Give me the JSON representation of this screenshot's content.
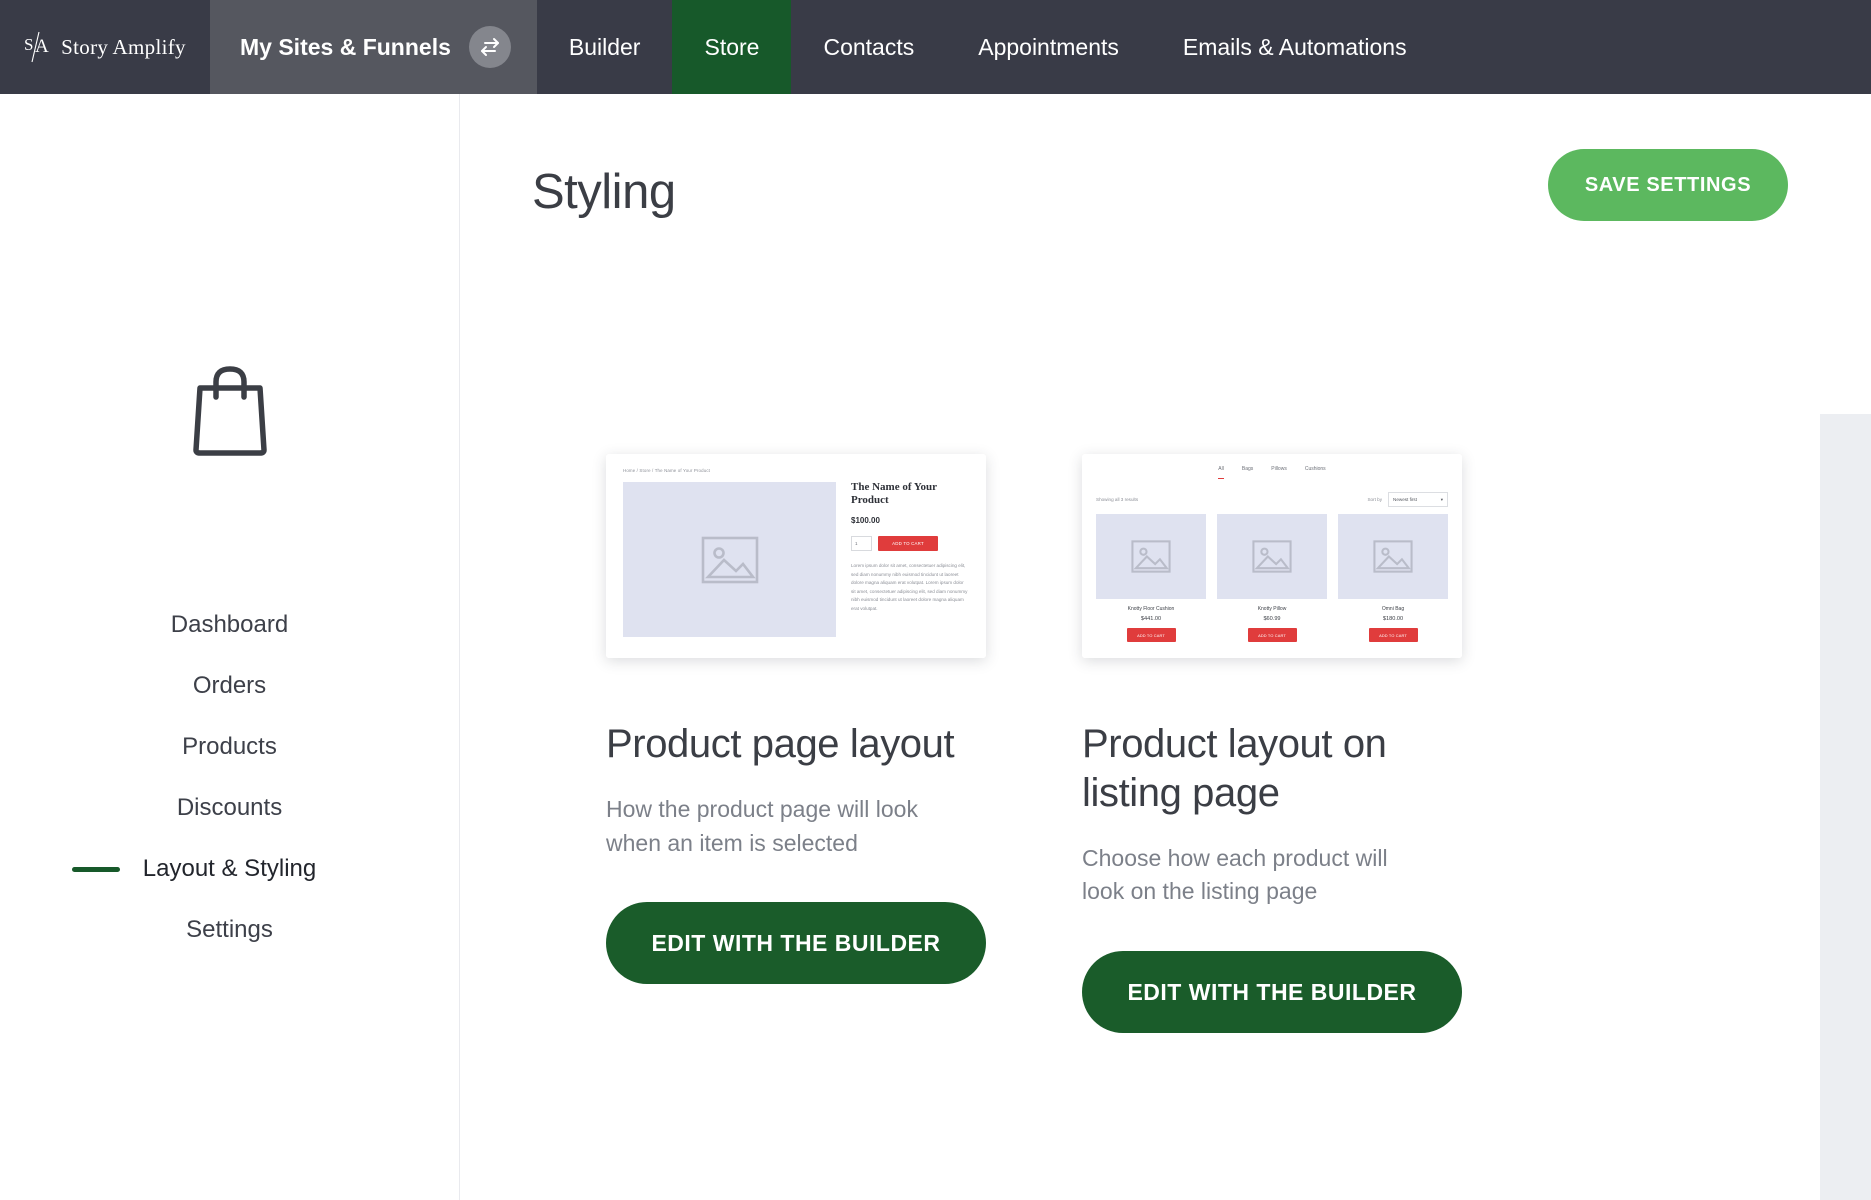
{
  "brand": {
    "name": "Story Amplify",
    "logo_icon": "story-amplify-monogram"
  },
  "topnav": {
    "tabs": [
      {
        "label": "My Sites & Funnels",
        "active": true,
        "icon": "swap-arrows-icon"
      },
      {
        "label": "Builder",
        "active": false
      },
      {
        "label": "Store",
        "active": true
      },
      {
        "label": "Contacts",
        "active": false
      },
      {
        "label": "Appointments",
        "active": false
      },
      {
        "label": "Emails & Automations",
        "active": false
      }
    ],
    "active_accent": "#17592a"
  },
  "sidebar": {
    "icon": "shopping-bag-icon",
    "items": [
      {
        "label": "Dashboard",
        "active": false
      },
      {
        "label": "Orders",
        "active": false
      },
      {
        "label": "Products",
        "active": false
      },
      {
        "label": "Discounts",
        "active": false
      },
      {
        "label": "Layout & Styling",
        "active": true
      },
      {
        "label": "Settings",
        "active": false
      }
    ],
    "active_indicator_color": "#17592a"
  },
  "header": {
    "title": "Styling",
    "save_label": "SAVE SETTINGS",
    "save_color": "#5cb85f"
  },
  "cards": [
    {
      "title": "Product page layout",
      "description": "How the product page will look when an item is selected",
      "button_label": "EDIT WITH THE BUILDER",
      "button_color": "#1a5c2a",
      "preview": {
        "type": "product-page",
        "breadcrumb": "Home  /  Store  /  The Name of Your Product",
        "product_name": "The Name of Your Product",
        "price": "$100.00",
        "quantity": "1",
        "add_to_cart_label": "ADD TO CART",
        "add_to_cart_color": "#e03c3c",
        "body_text": "Lorem ipsum dolor sit amet, consectetuer adipiscing elit, sed diam nonummy nibh euismod tincidunt ut laoreet dolore magna aliquam erat volutpat. Lorem ipsum dolor sit amet, consectetuer adipiscing elit, sed diam nonummy nibh euismod tincidunt ut laoreet dolore magna aliquam erat volutpat.",
        "image_placeholder_icon": "image-placeholder-icon"
      }
    },
    {
      "title": "Product layout on listing page",
      "description": "Choose how each product will look on the listing page",
      "button_label": "EDIT WITH THE BUILDER",
      "button_color": "#1a5c2a",
      "preview": {
        "type": "listing-page",
        "filter_tabs": [
          "All",
          "Bags",
          "Pillows",
          "Cushions"
        ],
        "active_filter": "All",
        "results_text": "Showing all 3 results",
        "sort_label": "Sort by",
        "sort_value": "Newest first",
        "add_to_cart_label": "ADD TO CART",
        "add_to_cart_color": "#e03c3c",
        "products": [
          {
            "name": "Knotty Floor Cushion",
            "price": "$441.00"
          },
          {
            "name": "Knotty Pillow",
            "price": "$60.99"
          },
          {
            "name": "Omni Bag",
            "price": "$180.00"
          }
        ]
      }
    }
  ]
}
